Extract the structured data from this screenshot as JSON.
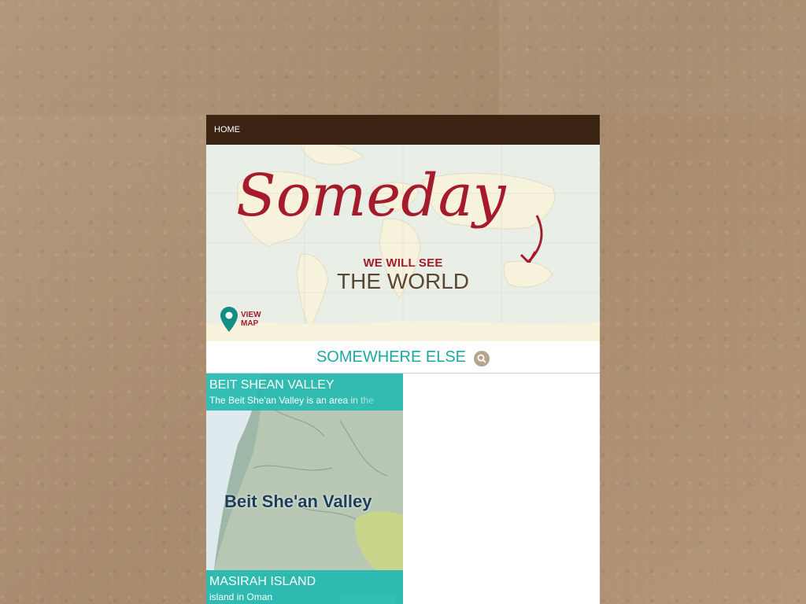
{
  "nav": {
    "home_label": "HOME"
  },
  "hero": {
    "title": "Someday",
    "subtitle_top": "WE WILL SEE",
    "subtitle_main": "THE WORLD",
    "view_map_line1": "VIEW",
    "view_map_line2": "MAP"
  },
  "section": {
    "title": "SOMEWHERE ELSE"
  },
  "cards": [
    {
      "name": "BEIT SHEAN VALLEY",
      "description": "The Beit She'an Valley is an area in the",
      "map_label": "Beit She'an Valley"
    },
    {
      "name": "MASIRAH ISLAND",
      "description": "island in Oman"
    }
  ],
  "colors": {
    "nav_bg": "#3b2414",
    "accent_teal": "#1ba99f",
    "card_overlay": "#26bab0",
    "accent_red": "#a51b2b",
    "text_brown": "#5b4634"
  },
  "icons": [
    "map-pin-icon",
    "search-icon",
    "arrow-icon"
  ]
}
